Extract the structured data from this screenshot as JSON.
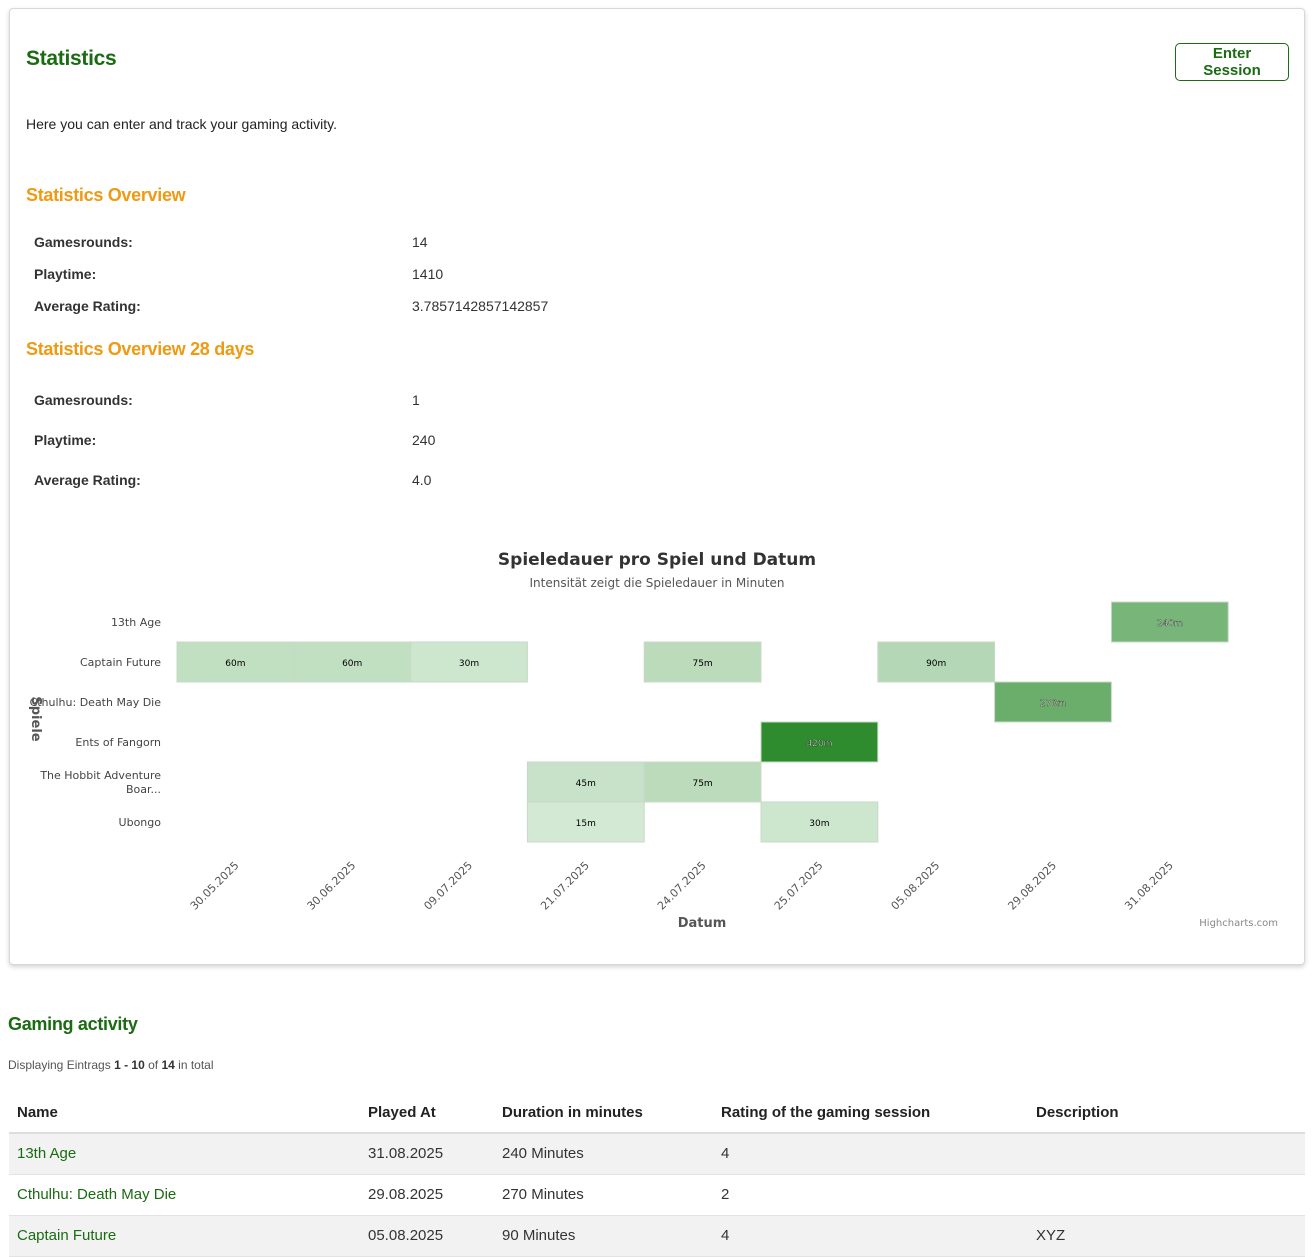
{
  "header": {
    "title": "Statistics",
    "enter_session_label": "Enter Session",
    "intro": "Here you can enter and track your gaming activity."
  },
  "overview": {
    "title": "Statistics Overview",
    "gamesrounds_label": "Gamesrounds:",
    "gamesrounds": "14",
    "playtime_label": "Playtime:",
    "playtime": "1410",
    "avg_rating_label": "Average Rating:",
    "avg_rating": "3.7857142857142857"
  },
  "overview28": {
    "title": "Statistics Overview 28 days",
    "gamesrounds_label": "Gamesrounds:",
    "gamesrounds": "1",
    "playtime_label": "Playtime:",
    "playtime": "240",
    "avg_rating_label": "Average Rating:",
    "avg_rating": "4.0"
  },
  "chart_data": {
    "type": "heatmap",
    "title": "Spieledauer pro Spiel und Datum",
    "subtitle": "Intensität zeigt die Spieledauer in Minuten",
    "xlabel": "Datum",
    "ylabel": "Spiele",
    "x": [
      "30.05.2025",
      "30.06.2025",
      "09.07.2025",
      "21.07.2025",
      "24.07.2025",
      "25.07.2025",
      "05.08.2025",
      "29.08.2025",
      "31.08.2025"
    ],
    "y": [
      "13th Age",
      "Captain Future",
      "Cthulhu: Death May Die",
      "Ents of Fangorn",
      "The Hobbit Adventure Boar...",
      "Ubongo"
    ],
    "cells": [
      {
        "x": "31.08.2025",
        "y": "13th Age",
        "value": 240,
        "label": "240m"
      },
      {
        "x": "30.05.2025",
        "y": "Captain Future",
        "value": 60,
        "label": "60m"
      },
      {
        "x": "30.06.2025",
        "y": "Captain Future",
        "value": 60,
        "label": "60m"
      },
      {
        "x": "09.07.2025",
        "y": "Captain Future",
        "value": 30,
        "label": "30m"
      },
      {
        "x": "24.07.2025",
        "y": "Captain Future",
        "value": 75,
        "label": "75m"
      },
      {
        "x": "05.08.2025",
        "y": "Captain Future",
        "value": 90,
        "label": "90m"
      },
      {
        "x": "29.08.2025",
        "y": "Cthulhu: Death May Die",
        "value": 270,
        "label": "270m"
      },
      {
        "x": "25.07.2025",
        "y": "Ents of Fangorn",
        "value": 420,
        "label": "420m"
      },
      {
        "x": "21.07.2025",
        "y": "The Hobbit Adventure Boar...",
        "value": 45,
        "label": "45m"
      },
      {
        "x": "24.07.2025",
        "y": "The Hobbit Adventure Boar...",
        "value": 75,
        "label": "75m"
      },
      {
        "x": "21.07.2025",
        "y": "Ubongo",
        "value": 15,
        "label": "15m"
      },
      {
        "x": "25.07.2025",
        "y": "Ubongo",
        "value": 30,
        "label": "30m"
      }
    ],
    "color_min": "#e8f5e9",
    "color_max": "#2e8b2e",
    "credit": "Highcharts.com"
  },
  "activity": {
    "title": "Gaming activity",
    "summary_prefix": "Displaying Eintrags",
    "summary_range": "1 - 10",
    "summary_of": "of",
    "summary_total": "14",
    "summary_suffix": "in total",
    "columns": [
      "Name",
      "Played At",
      "Duration in minutes",
      "Rating of the gaming session",
      "Description"
    ],
    "rows": [
      {
        "name": "13th Age",
        "played_at": "31.08.2025",
        "duration": "240 Minutes",
        "rating": "4",
        "description": ""
      },
      {
        "name": "Cthulhu: Death May Die",
        "played_at": "29.08.2025",
        "duration": "270 Minutes",
        "rating": "2",
        "description": ""
      },
      {
        "name": "Captain Future",
        "played_at": "05.08.2025",
        "duration": "90 Minutes",
        "rating": "4",
        "description": "XYZ"
      }
    ]
  },
  "colors": {
    "brand_green": "#1a6b12",
    "accent_orange": "#ef9a12"
  }
}
